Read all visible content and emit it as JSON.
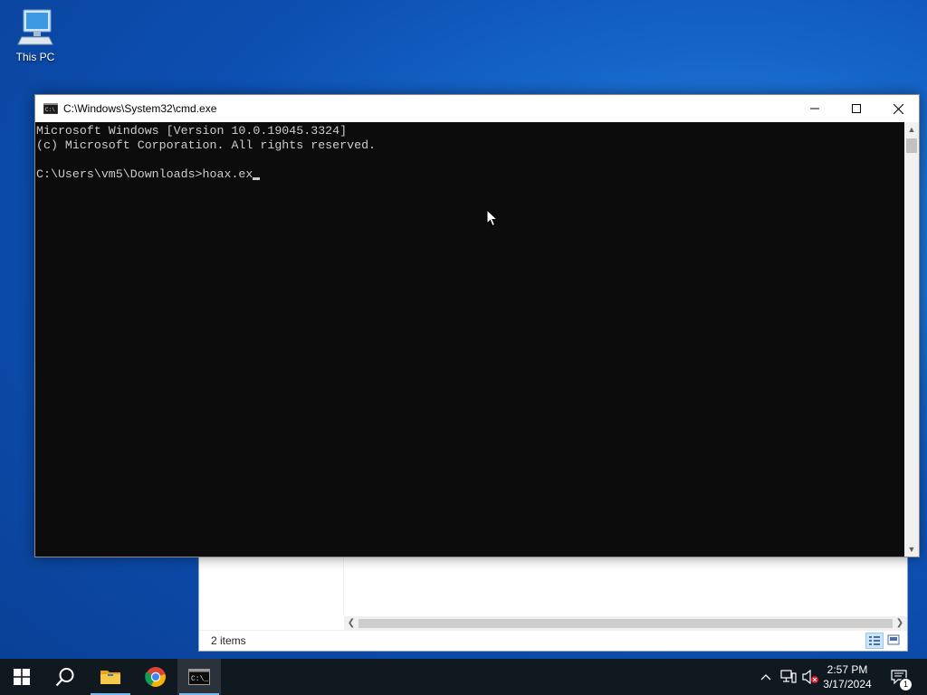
{
  "desktop": {
    "icons": [
      {
        "label": "This PC",
        "icon": "computer-icon"
      }
    ]
  },
  "explorer": {
    "status_text": "2 items"
  },
  "cmd_window": {
    "title": "C:\\Windows\\System32\\cmd.exe",
    "lines": [
      "Microsoft Windows [Version 10.0.19045.3324]",
      "(c) Microsoft Corporation. All rights reserved.",
      "",
      "C:\\Users\\vm5\\Downloads>hoax.ex"
    ]
  },
  "taskbar": {
    "buttons": [
      {
        "name": "start-button",
        "icon": "windows-logo-icon"
      },
      {
        "name": "search-button",
        "icon": "search-icon"
      },
      {
        "name": "file-explorer-button",
        "icon": "folder-icon"
      },
      {
        "name": "chrome-button",
        "icon": "chrome-icon"
      },
      {
        "name": "cmd-taskbar-button",
        "icon": "cmd-icon",
        "active": true
      }
    ],
    "clock": {
      "time": "2:57 PM",
      "date": "3/17/2024"
    },
    "notification_count": "1"
  },
  "colors": {
    "console_bg": "#0c0c0c",
    "console_text": "#cccccc",
    "taskbar_bg": "#101820",
    "accent": "#76b9ed"
  }
}
